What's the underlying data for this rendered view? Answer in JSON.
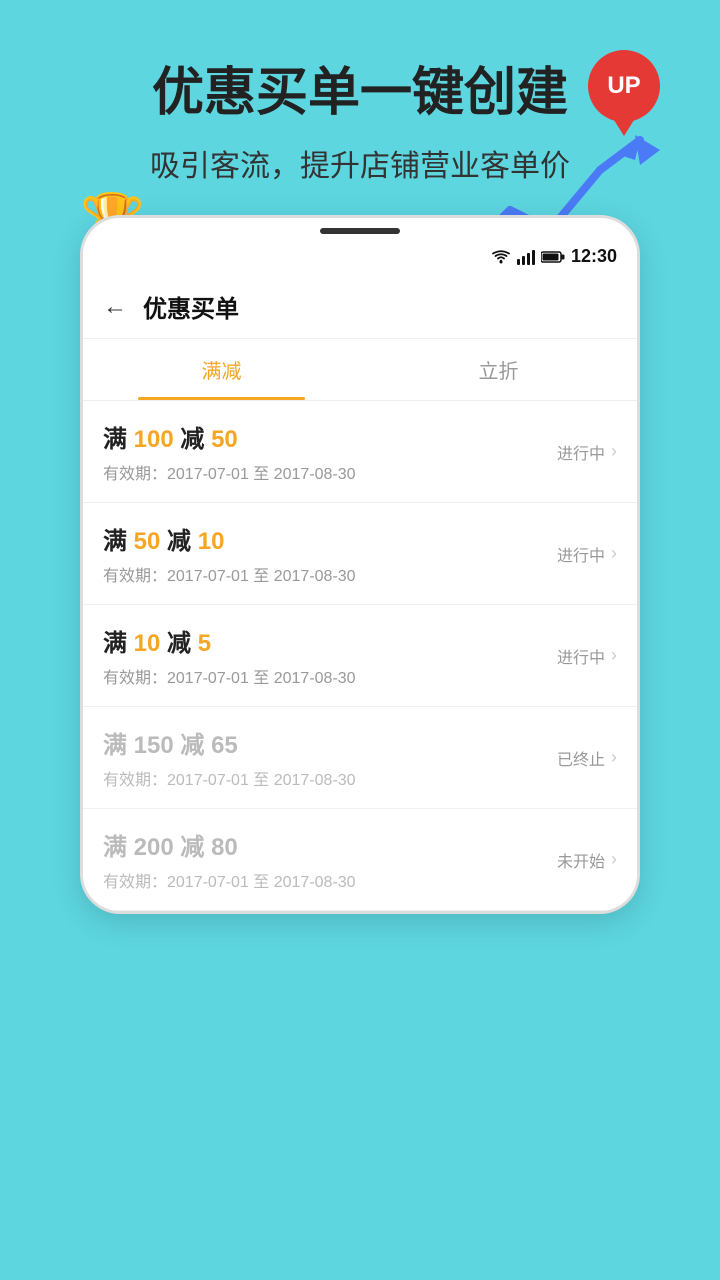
{
  "page": {
    "background_color": "#5dd6e0",
    "main_title": "优惠买单一键创建",
    "sub_title": "吸引客流，提升店铺营业客单价",
    "up_badge": "UP",
    "trophy_emoji": "🏆",
    "phone": {
      "status_bar": {
        "time": "12:30",
        "wifi_icon": "wifi",
        "signal_icon": "signal",
        "battery_icon": "battery"
      },
      "nav": {
        "back_icon": "←",
        "title": "优惠买单"
      },
      "tabs": [
        {
          "label": "满减",
          "active": true
        },
        {
          "label": "立折",
          "active": false
        }
      ],
      "deals": [
        {
          "id": 1,
          "main_text_prefix": "满",
          "amount1": "100",
          "middle_text": "减",
          "amount2": "50",
          "date": "有效期：2017-07-01 至 2017-08-30",
          "status": "进行中",
          "status_type": "ongoing",
          "inactive": false
        },
        {
          "id": 2,
          "main_text_prefix": "满",
          "amount1": "50",
          "middle_text": "减",
          "amount2": "10",
          "date": "有效期：2017-07-01 至 2017-08-30",
          "status": "进行中",
          "status_type": "ongoing",
          "inactive": false
        },
        {
          "id": 3,
          "main_text_prefix": "满",
          "amount1": "10",
          "middle_text": "减",
          "amount2": "5",
          "date": "有效期：2017-07-01 至 2017-08-30",
          "status": "进行中",
          "status_type": "ongoing",
          "inactive": false
        },
        {
          "id": 4,
          "main_text_prefix": "满",
          "amount1": "150",
          "middle_text": "减",
          "amount2": "65",
          "date": "有效期：2017-07-01 至 2017-08-30",
          "status": "已终止",
          "status_type": "ended",
          "inactive": true
        },
        {
          "id": 5,
          "main_text_prefix": "满",
          "amount1": "200",
          "middle_text": "减",
          "amount2": "80",
          "date": "有效期：2017-07-01 至 2017-08-30",
          "status": "未开始",
          "status_type": "upcoming",
          "inactive": true
        }
      ]
    }
  }
}
